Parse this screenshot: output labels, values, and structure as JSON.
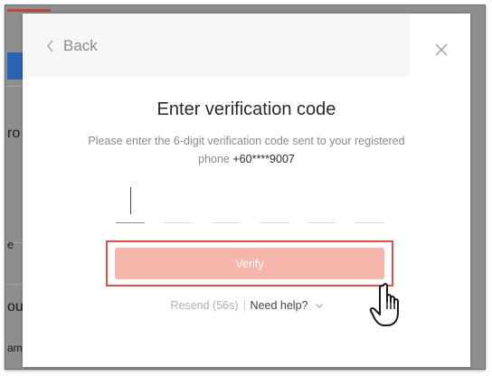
{
  "background": {
    "partial_texts": [
      "ro",
      "e",
      "ou",
      "am"
    ]
  },
  "modal": {
    "back_label": "Back",
    "title": "Enter verification code",
    "subtitle_text": "Please enter the 6-digit verification code sent to your registered phone",
    "phone": "+60****9007",
    "code_digits": [
      "",
      "",
      "",
      "",
      "",
      ""
    ],
    "verify_label": "Verify",
    "resend_label": "Resend (56s)",
    "help_label": "Need help?"
  },
  "colors": {
    "verify_button": "#f7b6ab",
    "highlight_outline": "#d9534a",
    "brand_blue": "#2c63b5"
  },
  "icons": {
    "back": "chevron-left-icon",
    "close": "close-icon",
    "help_dropdown": "chevron-down-icon",
    "pointer": "hand-pointer-icon"
  }
}
